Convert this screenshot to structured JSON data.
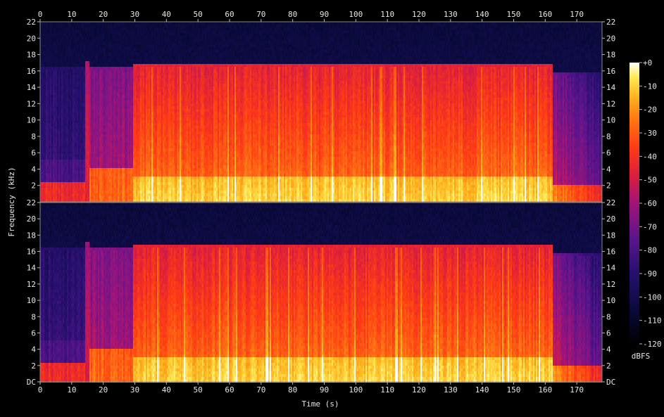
{
  "chart_data": {
    "type": "heatmap",
    "title": "",
    "xlabel": "Time (s)",
    "ylabel": "Frequency (kHz)",
    "xlim": [
      0,
      178
    ],
    "ylim": [
      0,
      22
    ],
    "x_ticks": [
      0,
      10,
      20,
      30,
      40,
      50,
      60,
      70,
      80,
      90,
      100,
      110,
      120,
      130,
      140,
      150,
      160,
      170
    ],
    "y_tick_labels_top": [
      "22",
      "20",
      "18",
      "16",
      "14",
      "12",
      "10",
      "8",
      "6",
      "4",
      "2"
    ],
    "y_tick_labels_bottom": [
      "22",
      "20",
      "18",
      "16",
      "14",
      "12",
      "10",
      "8",
      "6",
      "4",
      "2",
      "DC"
    ],
    "channels": 2,
    "colorbar": {
      "label": "dBFS",
      "range": [
        -120,
        0
      ],
      "ticks": [
        "+0",
        "-10",
        "-20",
        "-30",
        "-40",
        "-50",
        "-60",
        "-70",
        "-80",
        "-90",
        "-100",
        "-110",
        "-120"
      ]
    },
    "segments": [
      {
        "start": 0,
        "end": 14,
        "cutoff_khz": 16,
        "level": "quiet"
      },
      {
        "start": 14,
        "end": 15.5,
        "cutoff_khz": 16.8,
        "level": "transition"
      },
      {
        "start": 15.5,
        "end": 29,
        "cutoff_khz": 16,
        "level": "medium"
      },
      {
        "start": 29,
        "end": 162,
        "cutoff_khz": 16.5,
        "level": "loud"
      },
      {
        "start": 162,
        "end": 178,
        "cutoff_khz": 15.5,
        "level": "fade"
      }
    ]
  }
}
